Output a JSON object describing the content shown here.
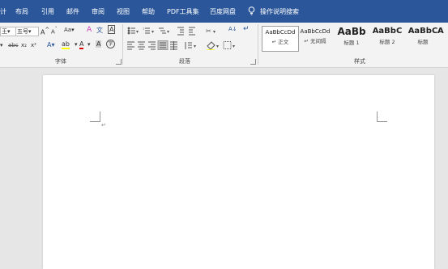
{
  "tabs": [
    "计",
    "布局",
    "引用",
    "邮件",
    "审阅",
    "视图",
    "帮助",
    "PDF工具集",
    "百度网盘",
    "操作说明搜索"
  ],
  "font": {
    "font_name": "王",
    "font_size": "五号",
    "grow": "A",
    "shrink": "A",
    "case": "Aa",
    "clear_format": "A",
    "phonetic": "文",
    "border_char": "A",
    "strike": "abc",
    "subscript": "x₂",
    "superscript": "x²",
    "effect": "A",
    "highlight": "ab",
    "font_color": "A",
    "shading": "A",
    "enclose": "字",
    "label": "字体"
  },
  "paragraph": {
    "label": "段落",
    "sort": "A↓",
    "show_marks": "↵"
  },
  "styles": {
    "label": "样式",
    "items": [
      {
        "sample": "AaBbCcDd",
        "name": "↵ 正文"
      },
      {
        "sample": "AaBbCcDd",
        "name": "↵ 无间隔"
      },
      {
        "sample": "AaBb",
        "name": "标题 1"
      },
      {
        "sample": "AaBbC",
        "name": "标题 2"
      },
      {
        "sample": "AaBbC",
        "name": "标题"
      },
      {
        "sample": "A",
        "name": ""
      }
    ]
  },
  "document": {
    "para_mark": "↵"
  },
  "colors": {
    "tabbar": "#2b579a",
    "ribbon": "#f3f3f3",
    "canvas": "#e6e6e6",
    "font_color_bar": "#e00000",
    "highlight_bar": "#ffff00"
  }
}
